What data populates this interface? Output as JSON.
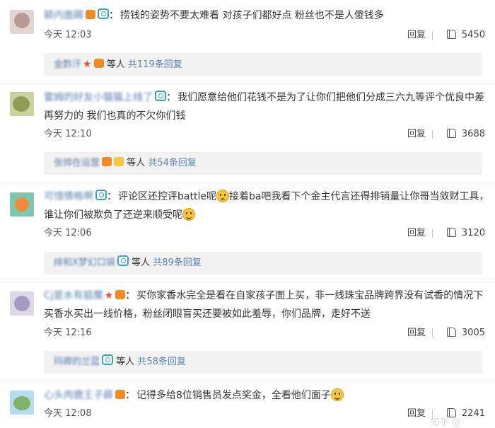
{
  "comments": [
    {
      "username": "颖内面踢",
      "text": "捞钱的姿势不要太难看 对孩子们都好点 粉丝也不是人傻钱多",
      "time": "今天 12:03",
      "reply_label": "回复",
      "likes": "5450",
      "sub_reply": {
        "name": "金酢汗",
        "suffix": "等人",
        "total": "共119条回复"
      },
      "avatar_color": "#d9c9c4"
    },
    {
      "username": "雷姆的好友小猫猫上线了",
      "text": "我们愿意给他们花钱不是为了让你们把他们分成三六九等评个优良中差再努力的 我们也真的不欠你们钱",
      "time": "今天 12:10",
      "reply_label": "回复",
      "likes": "3688",
      "sub_reply": {
        "name": "张帅在运营",
        "suffix": "等人",
        "total": "共54条回复"
      },
      "avatar_color": "#b7c48a"
    },
    {
      "username": "可惜情格啊",
      "text_a": "评论区还控评battle呢",
      "text_b": "接着ba吧我看下个金主代言还得排销量让你哥当敛财工具，谁让你们被欺负了还逆来顺受呢",
      "time": "今天 12:06",
      "reply_label": "回复",
      "likes": "3120",
      "sub_reply": {
        "name": "绯和X梦幻口袋",
        "suffix": "等人",
        "total": "共89条回复"
      },
      "avatar_color": "#f2a25c"
    },
    {
      "username": "Cj是水有掂魔",
      "text": "买你家香水完全是看在自家孩子面上买，非一线珠宝品牌跨界没有试香的情况下买香水买出一线价格，粉丝闭眼盲买还要被如此羞辱，你们品牌，走好不送",
      "time": "今天 12:16",
      "reply_label": "回复",
      "likes": "3005",
      "sub_reply": {
        "name": "玛卿的兰蓝",
        "suffix": "等人",
        "total": "共58条回复"
      },
      "avatar_color": "#c9c4d9"
    },
    {
      "username": "心头肉鹿王子薛",
      "text": "记得多给8位销售员发点奖金，全看他们面子",
      "time": "今天 12:08",
      "reply_label": "回复",
      "likes": "2241",
      "avatar_color": "#9dc9e0"
    }
  ],
  "watermark": "知乎 @"
}
